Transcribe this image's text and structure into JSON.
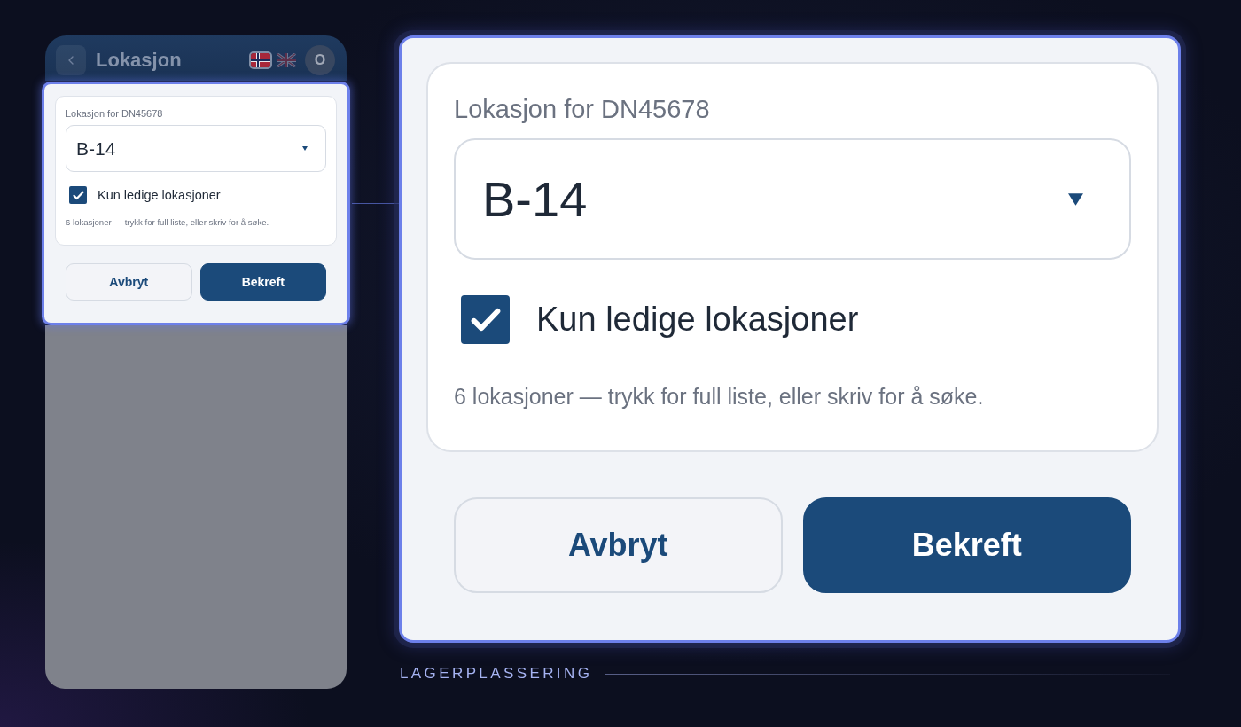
{
  "phone": {
    "header": {
      "title": "Lokasjon",
      "languages": [
        {
          "kind": "norwegian",
          "selected": true
        },
        {
          "kind": "english",
          "selected": false
        }
      ],
      "avatar": "O"
    },
    "dialog": {
      "label": "Lokasjon for DN45678",
      "select": {
        "value": "B-14"
      },
      "checkbox": {
        "label": "Kun ledige lokasjoner",
        "checked": true
      },
      "hint": "6 lokasjoner — trykk for full liste, eller skriv for å søke.",
      "buttons": [
        {
          "label": "Avbryt",
          "kind": "secondary"
        },
        {
          "label": "Bekreft",
          "kind": "primary"
        }
      ]
    }
  },
  "callout": {
    "dialog": {
      "label": "Lokasjon for DN45678",
      "select": {
        "value": "B-14"
      },
      "checkbox": {
        "label": "Kun ledige lokasjoner",
        "checked": true
      },
      "hint": "6 lokasjoner — trykk for full liste, eller skriv for å søke.",
      "buttons": [
        {
          "label": "Avbryt",
          "kind": "secondary"
        },
        {
          "label": "Bekreft",
          "kind": "primary"
        }
      ]
    },
    "caption": "LAGERPLASSERING"
  }
}
